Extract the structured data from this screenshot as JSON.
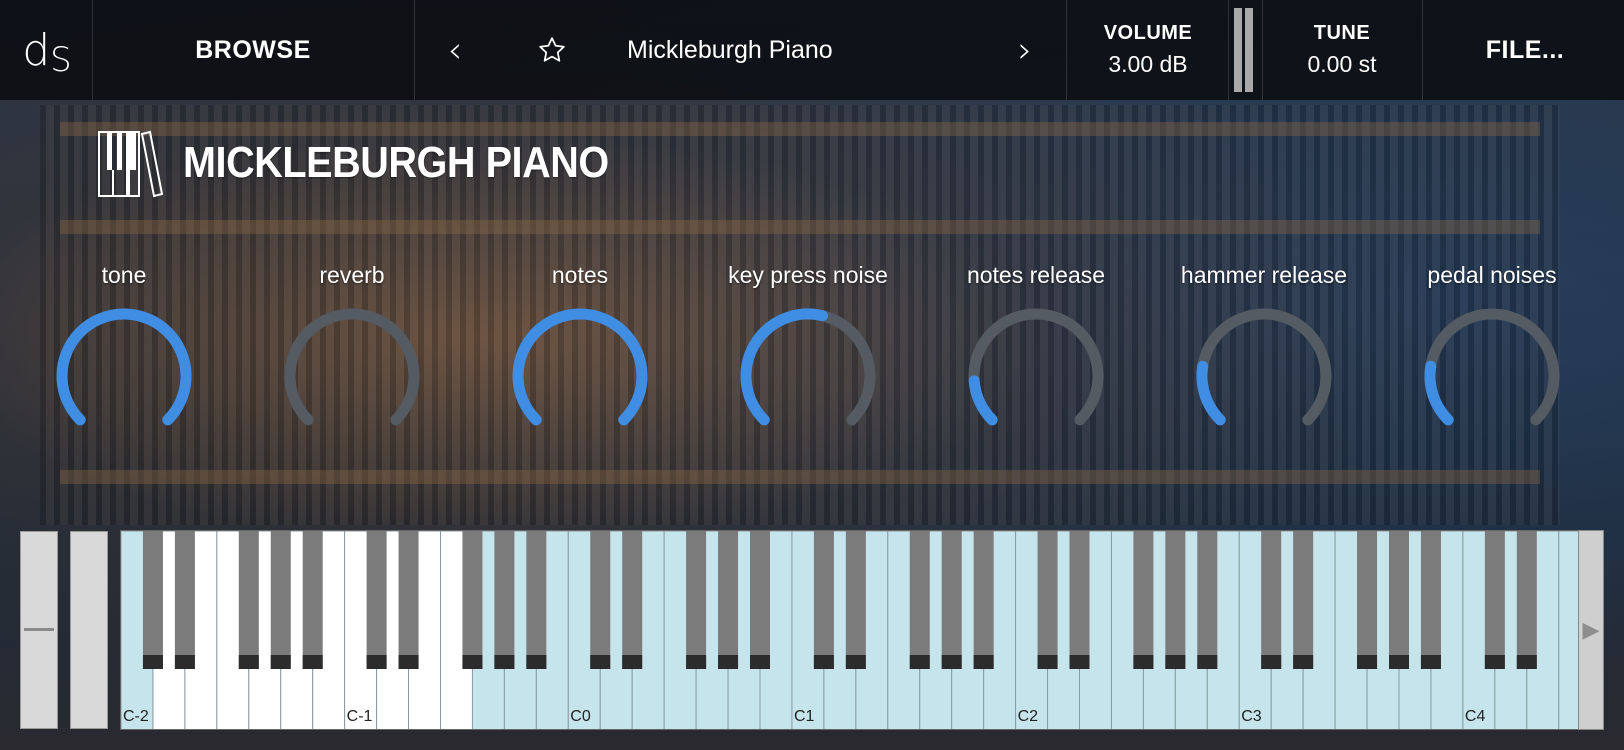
{
  "topbar": {
    "logo_main": "d",
    "logo_sub": "S",
    "browse_label": "BROWSE",
    "prev_icon": "chevron-left-icon",
    "next_icon": "chevron-right-icon",
    "favorite_icon": "star-icon",
    "preset_name": "Mickleburgh Piano",
    "volume": {
      "label": "VOLUME",
      "value": "3.00 dB"
    },
    "tune": {
      "label": "TUNE",
      "value": "0.00 st"
    },
    "file_label": "FILE..."
  },
  "instrument": {
    "title": "MICKLEBURGH PIANO",
    "icon": "piano-keys-icon"
  },
  "knobs": [
    {
      "label": "tone",
      "value": 1.0
    },
    {
      "label": "reverb",
      "value": 0.0
    },
    {
      "label": "notes",
      "value": 1.0
    },
    {
      "label": "key press noise",
      "value": 0.55
    },
    {
      "label": "notes release",
      "value": 0.15
    },
    {
      "label": "hammer release",
      "value": 0.2
    },
    {
      "label": "pedal noises",
      "value": 0.2
    }
  ],
  "keyboard": {
    "octave_labels": [
      "C-2",
      "C-1",
      "C0",
      "C1",
      "C2",
      "C3",
      "C4"
    ],
    "active_range_start_label": "C0",
    "active_color": "#c6e4ec",
    "black_key_color": "#7b7b7b"
  },
  "colors": {
    "accent": "#3f8ee4",
    "knob_track": "#555b63"
  }
}
